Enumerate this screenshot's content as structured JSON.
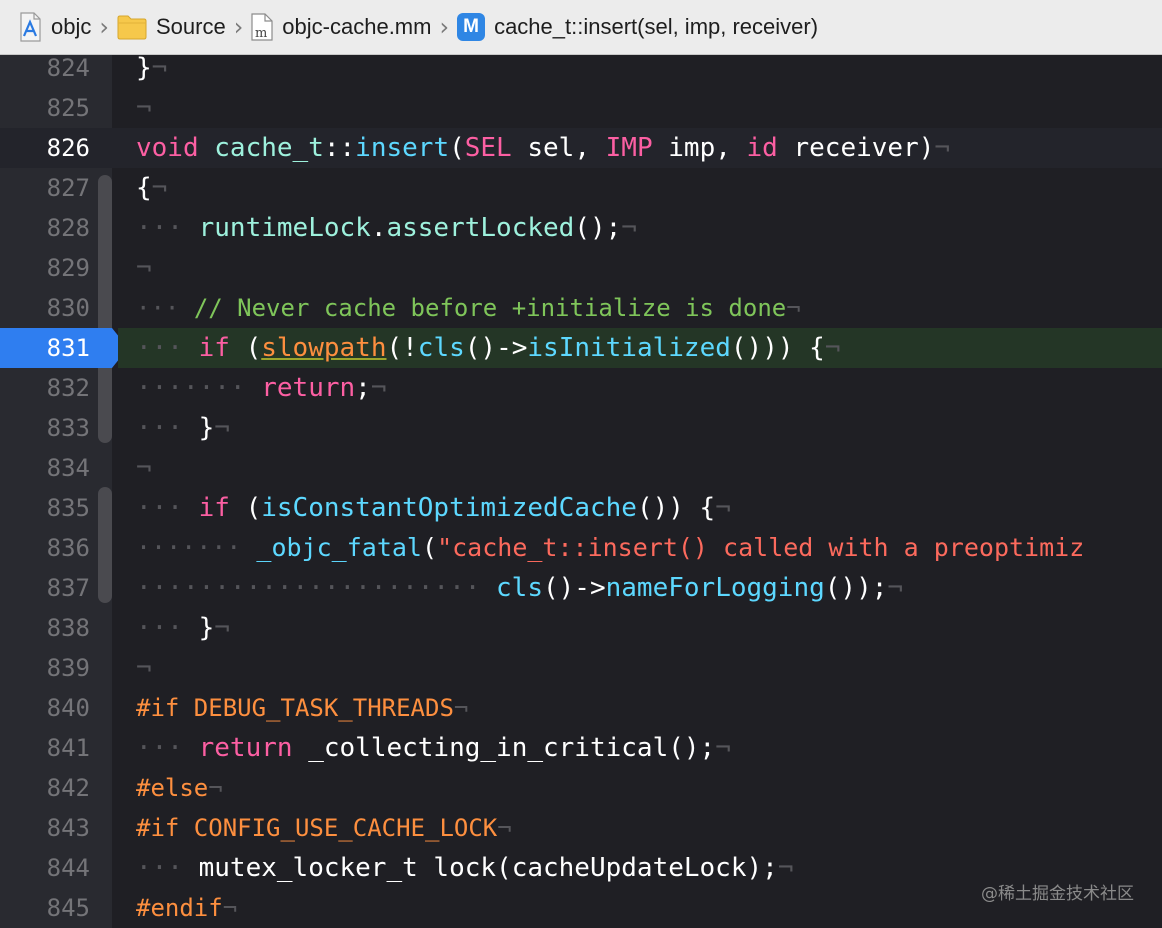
{
  "breadcrumb": {
    "project": "objc",
    "folder": "Source",
    "file": "objc-cache.mm",
    "method_icon_letter": "M",
    "method": "cache_t::insert(sel, imp, receiver)"
  },
  "editor": {
    "current_line": "826",
    "breakpoint_line": "831",
    "lines": [
      {
        "n": "824"
      },
      {
        "n": "825"
      },
      {
        "n": "826"
      },
      {
        "n": "827"
      },
      {
        "n": "828"
      },
      {
        "n": "829"
      },
      {
        "n": "830"
      },
      {
        "n": "831"
      },
      {
        "n": "832"
      },
      {
        "n": "833"
      },
      {
        "n": "834"
      },
      {
        "n": "835"
      },
      {
        "n": "836"
      },
      {
        "n": "837"
      },
      {
        "n": "838"
      },
      {
        "n": "839"
      },
      {
        "n": "840"
      },
      {
        "n": "841"
      },
      {
        "n": "842"
      },
      {
        "n": "843"
      },
      {
        "n": "844"
      },
      {
        "n": "845"
      }
    ],
    "code": {
      "l824_brace": "}",
      "l826_void": "void",
      "l826_class": "cache_t",
      "l826_sep": "::",
      "l826_fn": "insert",
      "l826_sel_t": "SEL",
      "l826_sel": " sel, ",
      "l826_imp_t": "IMP",
      "l826_imp": " imp, ",
      "l826_id_t": "id",
      "l826_recv": " receiver)",
      "l827": "{",
      "l828_obj": "runtimeLock",
      "l828_dot": ".",
      "l828_fn": "assertLocked",
      "l828_end": "();",
      "l830_comment": "// Never cache before +initialize is done",
      "l831_if": "if",
      "l831_open": " (",
      "l831_slow": "slowpath",
      "l831_not": "(!",
      "l831_cls": "cls",
      "l831_arrow": "()->",
      "l831_init": "isInitialized",
      "l831_end": "())) {",
      "l832_return": "return",
      "l832_end": ";",
      "l833": "}",
      "l835_if": "if",
      "l835_open": " (",
      "l835_fn": "isConstantOptimizedCache",
      "l835_end": "()) {",
      "l836_fn": "_objc_fatal",
      "l836_open": "(",
      "l836_str": "\"cache_t::insert() called with a preoptimiz",
      "l837_cls": "cls",
      "l837_arrow": "()->",
      "l837_fn": "nameForLogging",
      "l837_end": "());",
      "l838": "}",
      "l840_if": "#if",
      "l840_macro": " DEBUG_TASK_THREADS",
      "l841_return": "return",
      "l841_rest": " _collecting_in_critical();",
      "l842": "#else",
      "l843_if": "#if",
      "l843_macro": " CONFIG_USE_CACHE_LOCK",
      "l844": "mutex_locker_t lock(cacheUpdateLock);",
      "l845": "#endif"
    }
  },
  "watermark": "@稀土掘金技术社区",
  "colors": {
    "keyword": "#fc5fa3",
    "type": "#5dd8ff",
    "function": "#67b7a4",
    "comment": "#7fc55a",
    "string": "#fc6a5d",
    "preprocessor": "#fd8f3f",
    "breakpoint": "#2f7ef0",
    "breakpoint_line_bg": "#243626"
  }
}
